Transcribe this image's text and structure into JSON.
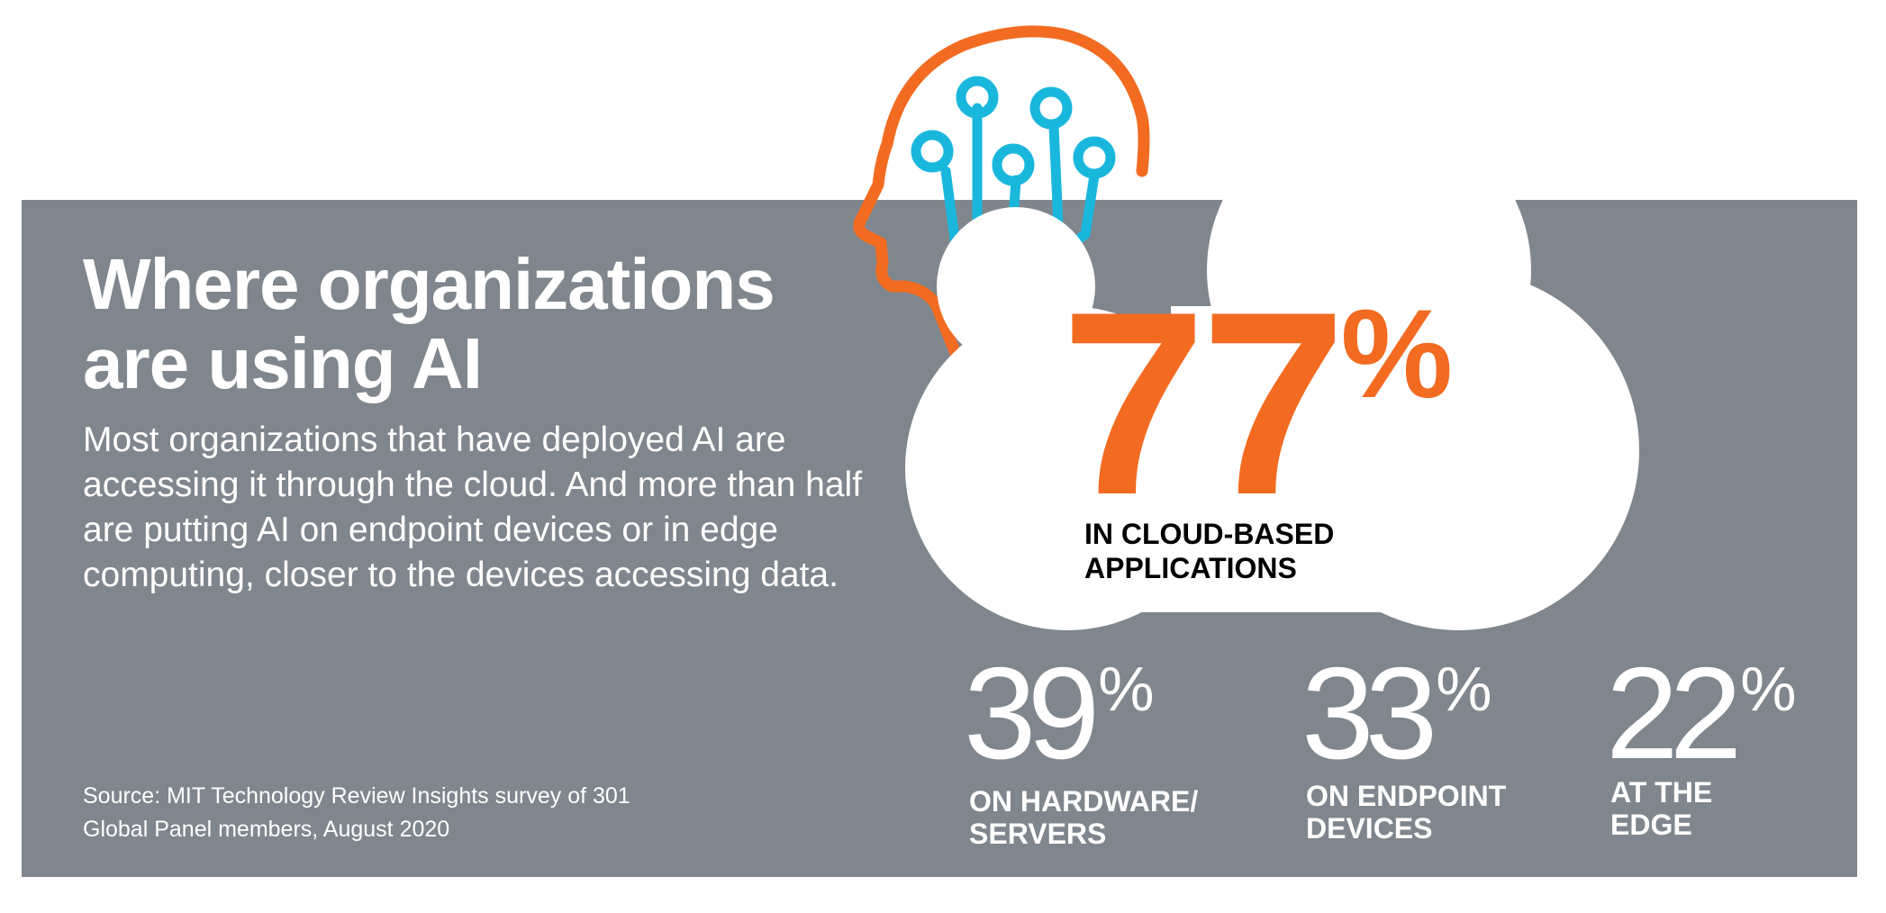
{
  "title": "Where organizations are using AI",
  "description": "Most organizations that have deployed AI are accessing it through the cloud. And more than half are putting AI on endpoint devices or in edge computing, closer to the devices accessing data.",
  "source": "Source: MIT Technology Review Insights survey of 301 Global Panel members, August 2020",
  "colors": {
    "panel": "#7f868d",
    "accent_orange": "#f26b21",
    "accent_cyan": "#1ab7dd",
    "text": "#ffffff"
  },
  "icons": [
    "ai-head-circuit-icon",
    "cloud-icon"
  ],
  "stats": {
    "cloud": {
      "value": "77",
      "unit": "%",
      "label": "IN CLOUD-BASED APPLICATIONS"
    },
    "hardware": {
      "value": "39",
      "unit": "%",
      "label": "ON HARDWARE/ SERVERS"
    },
    "endpoint": {
      "value": "33",
      "unit": "%",
      "label": "ON ENDPOINT DEVICES"
    },
    "edge": {
      "value": "22",
      "unit": "%",
      "label": "AT THE EDGE"
    }
  }
}
